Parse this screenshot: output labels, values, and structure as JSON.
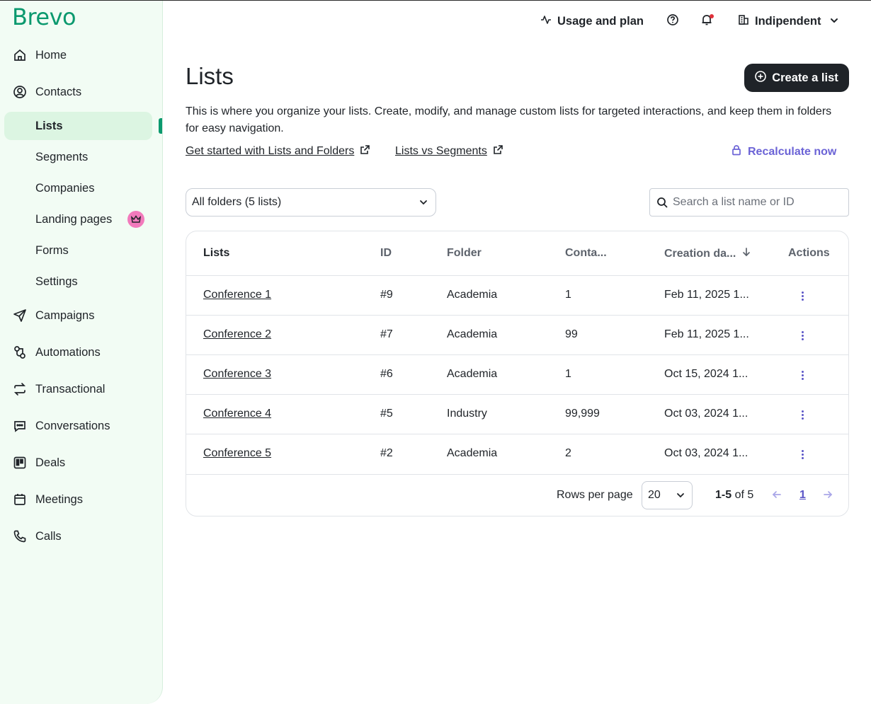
{
  "brand": {
    "logo": "Brevo",
    "accent": "#0b996e"
  },
  "sidebar": {
    "items": [
      {
        "label": "Home",
        "icon": "home-icon"
      },
      {
        "label": "Contacts",
        "icon": "contacts-icon"
      },
      {
        "label": "Campaigns",
        "icon": "paper-plane-icon"
      },
      {
        "label": "Automations",
        "icon": "automation-icon"
      },
      {
        "label": "Transactional",
        "icon": "swap-icon"
      },
      {
        "label": "Conversations",
        "icon": "chat-icon"
      },
      {
        "label": "Deals",
        "icon": "kanban-icon"
      },
      {
        "label": "Meetings",
        "icon": "calendar-icon"
      },
      {
        "label": "Calls",
        "icon": "phone-icon"
      }
    ],
    "contacts_sub": [
      {
        "label": "Lists",
        "active": true
      },
      {
        "label": "Segments"
      },
      {
        "label": "Companies"
      },
      {
        "label": "Landing pages",
        "badge": "crown-icon"
      },
      {
        "label": "Forms"
      },
      {
        "label": "Settings"
      }
    ]
  },
  "topbar": {
    "usage": "Usage and plan",
    "account": "Indipendent"
  },
  "page": {
    "title": "Lists",
    "create_button": "Create a list",
    "description": "This is where you organize your lists. Create, modify, and manage custom lists for targeted interactions, and keep them in folders for easy navigation.",
    "link1": "Get started with Lists and Folders",
    "link2": "Lists vs Segments",
    "recalculate": "Recalculate now",
    "folder_filter": "All folders (5 lists)",
    "search_placeholder": "Search a list name or ID"
  },
  "table": {
    "columns": [
      "Lists",
      "ID",
      "Folder",
      "Conta...",
      "Creation da...",
      "Actions"
    ],
    "rows": [
      {
        "name": "Conference 1",
        "id": "#9",
        "folder": "Academia",
        "contacts": "1",
        "created": "Feb 11, 2025 1..."
      },
      {
        "name": "Conference 2",
        "id": "#7",
        "folder": "Academia",
        "contacts": "99",
        "created": "Feb 11, 2025 1..."
      },
      {
        "name": "Conference 3",
        "id": "#6",
        "folder": "Academia",
        "contacts": "1",
        "created": "Oct 15, 2024 1..."
      },
      {
        "name": "Conference 4",
        "id": "#5",
        "folder": "Industry",
        "contacts": "99,999",
        "created": "Oct 03, 2024 1..."
      },
      {
        "name": "Conference 5",
        "id": "#2",
        "folder": "Academia",
        "contacts": "2",
        "created": "Oct 03, 2024 1..."
      }
    ]
  },
  "pagination": {
    "rows_per_page_label": "Rows per page",
    "rows_per_page": "20",
    "range": "1-5",
    "of_total": "of 5",
    "current_page": "1"
  }
}
